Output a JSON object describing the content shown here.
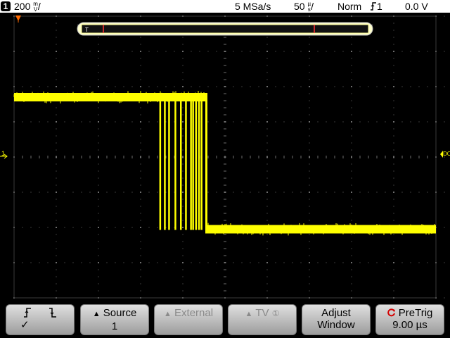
{
  "topbar": {
    "channel_number": "1",
    "volts_per_div": "200",
    "volts_unit_top": "m",
    "volts_unit_bottom": "V",
    "sample_rate": "5 MSa/s",
    "time_per_div": "50",
    "time_unit_top": "µ",
    "time_unit_bottom": "s",
    "trigger_mode": "Norm",
    "trigger_source": "1",
    "trigger_level": "0.0 V"
  },
  "screen": {
    "ground_marker": "1",
    "trigger_level_marker": "DC",
    "overview_trigger_marker": "T",
    "trace_color": "#ffff00",
    "grid_color": "#6e6e6e",
    "signal": {
      "high_level_volts": 0.34,
      "low_level_volts": -0.41,
      "falling_edge_divisions": 4.55,
      "glitch_positions_divisions": [
        3.46,
        3.57,
        3.67,
        3.82,
        3.95,
        4.07,
        4.19,
        4.24,
        4.31,
        4.38,
        4.44
      ]
    }
  },
  "softkeys": {
    "slope": {
      "rising_icon": "rising-edge-icon",
      "falling_icon": "falling-edge-icon",
      "check_label": "✓"
    },
    "source": {
      "label": "Source",
      "value": "1",
      "arrow": "▲"
    },
    "external": {
      "label": "External",
      "arrow": "▲"
    },
    "tv": {
      "label": "TV",
      "badge": "①",
      "arrow": "▲"
    },
    "adjust": {
      "line1": "Adjust",
      "line2": "Window"
    },
    "pretrig": {
      "label": "PreTrig",
      "value": "9.00 µs",
      "icon": "rotate-knob-icon"
    }
  }
}
